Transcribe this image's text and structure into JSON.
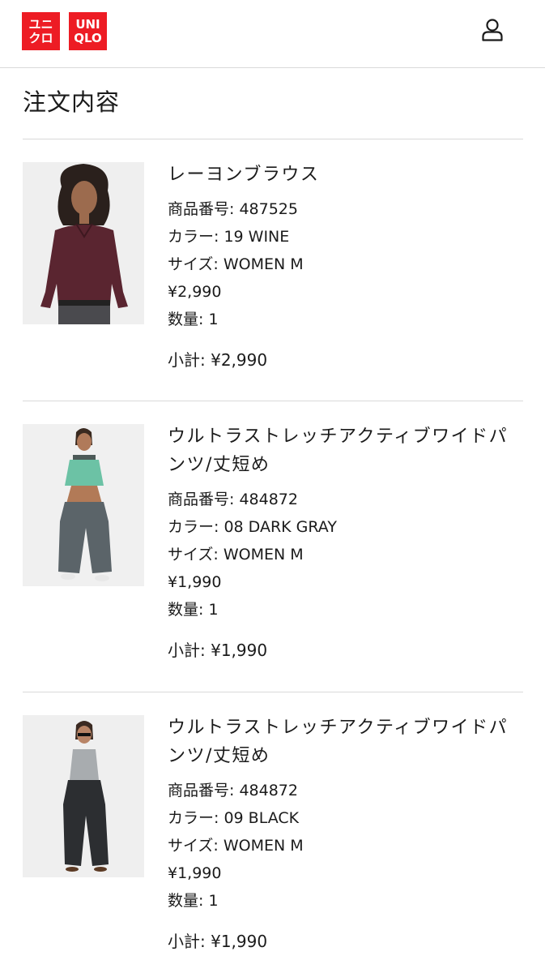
{
  "header": {
    "logo_katakana": [
      "ユニ",
      "クロ"
    ],
    "logo_latin": [
      "UNI",
      "QLO"
    ],
    "brand_color": "#ed1c24",
    "account_icon": "user-icon"
  },
  "page_title": "注文内容",
  "items": [
    {
      "name": "レーヨンブラウス",
      "product_no": "商品番号: 487525",
      "color": "カラー: 19 WINE",
      "size": "サイズ: WOMEN M",
      "price": "¥2,990",
      "quantity": "数量: 1",
      "subtotal": "小計: ¥2,990"
    },
    {
      "name": "ウルトラストレッチアクティブワイドパンツ/丈短め",
      "product_no": "商品番号: 484872",
      "color": "カラー: 08 DARK GRAY",
      "size": "サイズ: WOMEN M",
      "price": "¥1,990",
      "quantity": "数量: 1",
      "subtotal": "小計: ¥1,990"
    },
    {
      "name": "ウルトラストレッチアクティブワイドパンツ/丈短め",
      "product_no": "商品番号: 484872",
      "color": "カラー: 09 BLACK",
      "size": "サイズ: WOMEN M",
      "price": "¥1,990",
      "quantity": "数量: 1",
      "subtotal": "小計: ¥1,990"
    }
  ]
}
